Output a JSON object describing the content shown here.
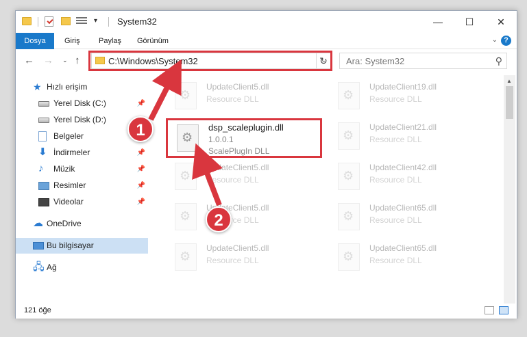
{
  "window": {
    "title": "System32",
    "qa_arrow": "▾",
    "min_symbol": "—",
    "max_symbol": "☐",
    "close_symbol": "✕"
  },
  "ribbon": {
    "tabs": [
      {
        "label": "Dosya"
      },
      {
        "label": "Giriş"
      },
      {
        "label": "Paylaş"
      },
      {
        "label": "Görünüm"
      }
    ],
    "expand_symbol": "⌄",
    "help_symbol": "?"
  },
  "nav": {
    "back": "←",
    "forward": "→",
    "recent": "⌄",
    "up": "↑",
    "address": "C:\\Windows\\System32",
    "address_dropdown": "⌄",
    "refresh": "↻",
    "search_placeholder": "Ara: System32",
    "search_icon": "⚲"
  },
  "sidebar": {
    "items": [
      {
        "label": "Hızlı erişim",
        "icon": "star-icon"
      },
      {
        "label": "Yerel Disk (C:)",
        "icon": "disk-icon",
        "pinned": true
      },
      {
        "label": "Yerel Disk (D:)",
        "icon": "disk-icon",
        "pinned": false
      },
      {
        "label": "Belgeler",
        "icon": "document-icon",
        "pinned": true
      },
      {
        "label": "İndirmeler",
        "icon": "download-icon",
        "pinned": true
      },
      {
        "label": "Müzik",
        "icon": "music-icon",
        "pinned": true
      },
      {
        "label": "Resimler",
        "icon": "pictures-icon",
        "pinned": true
      },
      {
        "label": "Videolar",
        "icon": "videos-icon",
        "pinned": true
      },
      {
        "label": "OneDrive",
        "icon": "cloud-icon"
      },
      {
        "label": "Bu bilgisayar",
        "icon": "computer-icon",
        "selected": true
      },
      {
        "label": "Ağ",
        "icon": "network-icon"
      }
    ],
    "pin_symbol": "📌"
  },
  "files": {
    "left": [
      {
        "name": "UpdateClient5.dll",
        "type": "Resource DLL"
      },
      {
        "name": "UpdateClient5.dll",
        "type": "Resource DLL"
      },
      {
        "name": "UpdateClient5.dll",
        "type": "Resource DLL"
      },
      {
        "name": "UpdateClient5.dll",
        "type": "Resource DLL"
      }
    ],
    "right": [
      {
        "name": "UpdateClient19.dll",
        "type": "Resource DLL"
      },
      {
        "name": "UpdateClient21.dll",
        "type": "Resource DLL"
      },
      {
        "name": "UpdateClient42.dll",
        "type": "Resource DLL"
      },
      {
        "name": "UpdateClient65.dll",
        "type": "Resource DLL"
      },
      {
        "name": "UpdateClient65.dll",
        "type": "Resource DLL"
      }
    ],
    "highlighted": {
      "name": "dsp_scaleplugin.dll",
      "version": "1.0.0.1",
      "description": "ScalePlugIn DLL"
    }
  },
  "status": {
    "count": "121 öğe"
  },
  "annotations": {
    "step1": "1",
    "step2": "2",
    "color": "#d9363e"
  },
  "scroll": {
    "up": "▲",
    "down": "▼"
  }
}
